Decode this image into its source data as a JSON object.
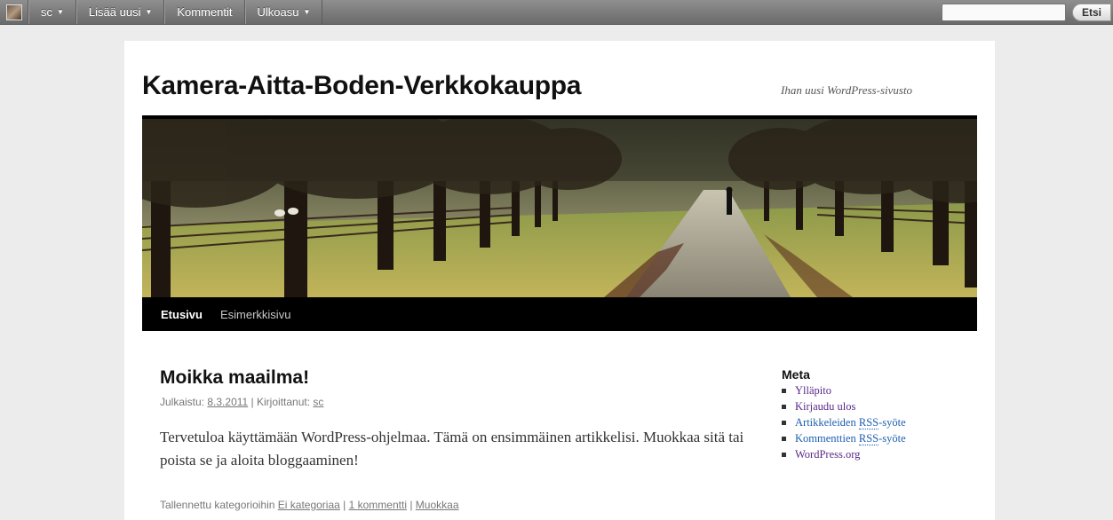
{
  "adminbar": {
    "user": "sc",
    "items": [
      "Lisää uusi",
      "Kommentit",
      "Ulkoasu"
    ],
    "search_value": "",
    "search_button": "Etsi"
  },
  "site": {
    "title": "Kamera-Aitta-Boden-Verkkokauppa",
    "description": "Ihan uusi WordPress-sivusto"
  },
  "nav": {
    "items": [
      "Etusivu",
      "Esimerkkisivu"
    ]
  },
  "post": {
    "title": "Moikka maailma!",
    "meta_published_label": "Julkaistu:",
    "meta_date": "8.3.2011",
    "meta_author_label": "Kirjoittanut:",
    "meta_author": "sc",
    "body": "Tervetuloa käyttämään WordPress-ohjelmaa. Tämä on ensimmäinen artikkelisi. Muokkaa sitä tai poista se ja aloita bloggaaminen!",
    "footer_label": "Tallennettu kategorioihin",
    "category": "Ei kategoriaa",
    "comments": "1 kommentti",
    "edit": "Muokkaa"
  },
  "sidebar": {
    "heading": "Meta",
    "items": [
      "Ylläpito",
      "Kirjaudu ulos",
      "Artikkeleiden",
      "RSS",
      "-syöte",
      "Kommenttien",
      "RSS",
      "-syöte",
      "WordPress.org"
    ]
  }
}
